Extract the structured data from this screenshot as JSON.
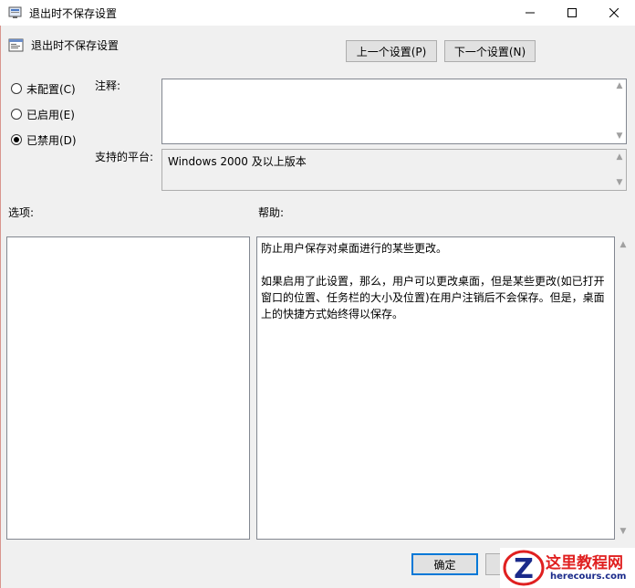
{
  "window": {
    "title": "退出时不保存设置",
    "header_title": "退出时不保存设置"
  },
  "nav": {
    "prev_label": "上一个设置(P)",
    "next_label": "下一个设置(N)"
  },
  "state": {
    "options": [
      {
        "label": "未配置(C)",
        "checked": false
      },
      {
        "label": "已启用(E)",
        "checked": false
      },
      {
        "label": "已禁用(D)",
        "checked": true
      }
    ]
  },
  "fields": {
    "comment_label": "注释:",
    "comment_value": "",
    "platform_label": "支持的平台:",
    "platform_value": "Windows 2000 及以上版本"
  },
  "sections": {
    "options_label": "选项:",
    "help_label": "帮助:"
  },
  "help": {
    "paragraph1": "防止用户保存对桌面进行的某些更改。",
    "paragraph2": "如果启用了此设置，那么，用户可以更改桌面，但是某些更改(如已打开窗口的位置、任务栏的大小及位置)在用户注销后不会保存。但是，桌面上的快捷方式始终得以保存。"
  },
  "footer": {
    "ok_label": "确定",
    "cancel_label": ""
  },
  "watermark": {
    "name": "这里教程网",
    "url": "herecours.com"
  }
}
